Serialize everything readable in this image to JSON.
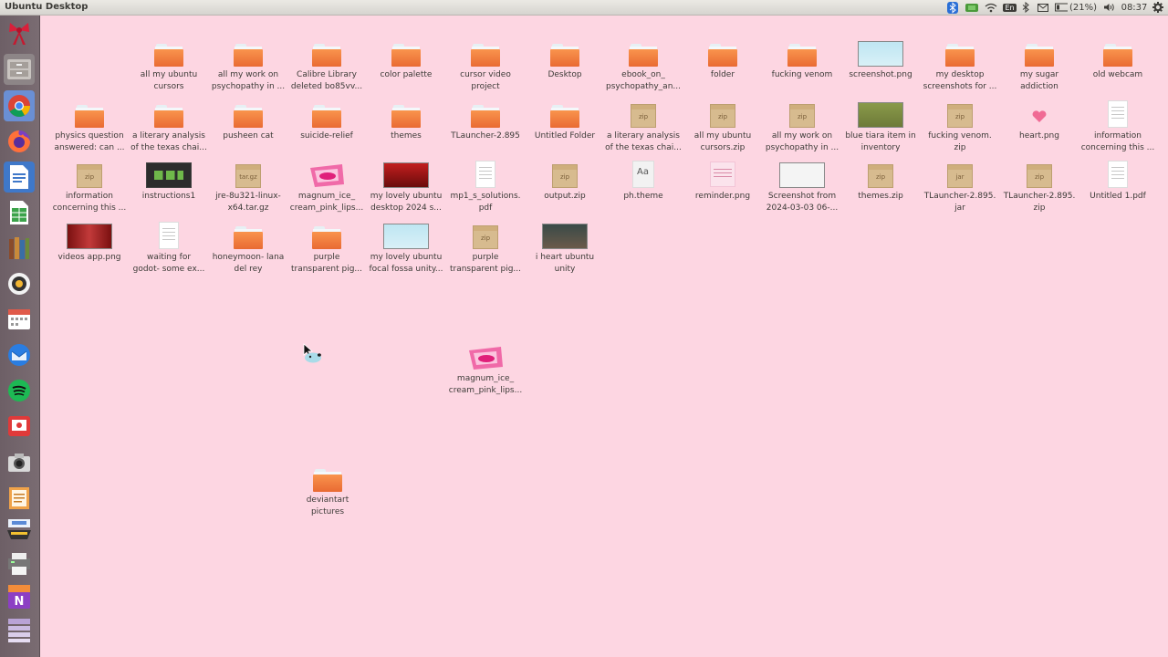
{
  "panel": {
    "title": "Ubuntu Desktop",
    "battery": "(21%)",
    "keyboard": "En",
    "time": "08:37"
  },
  "launcher": {
    "items": [
      "ribbon",
      "files",
      "chrome",
      "firefox",
      "writer",
      "calc",
      "books",
      "rhythmbox",
      "calendar",
      "thunderbird",
      "spotify",
      "screencast",
      "camera",
      "notes",
      "scanner",
      "onenote"
    ]
  },
  "desktop": {
    "icons": [
      {
        "id": "i1",
        "name": "all my ubuntu cursors",
        "l1": "all my ubuntu",
        "l2": "cursors",
        "type": "folder"
      },
      {
        "id": "i2",
        "name": "all my work on psychopathy",
        "l1": "all my work on",
        "l2": "psychopathy in ...",
        "type": "folder"
      },
      {
        "id": "i3",
        "name": "Calibre Library",
        "l1": "Calibre Library",
        "l2": "deleted bo85vv...",
        "type": "folder"
      },
      {
        "id": "i4",
        "name": "color palette",
        "l1": "color palette",
        "l2": "",
        "type": "folder"
      },
      {
        "id": "i5",
        "name": "cursor video project",
        "l1": "cursor video",
        "l2": "project",
        "type": "folder"
      },
      {
        "id": "i6",
        "name": "Desktop",
        "l1": "Desktop",
        "l2": "",
        "type": "folder"
      },
      {
        "id": "i7",
        "name": "ebook on psychopathy",
        "l1": "ebook_on_",
        "l2": "psychopathy_an...",
        "type": "folder"
      },
      {
        "id": "i8",
        "name": "folder",
        "l1": "folder",
        "l2": "",
        "type": "folder"
      },
      {
        "id": "i9",
        "name": "fucking venom",
        "l1": "fucking venom",
        "l2": "",
        "type": "folder"
      },
      {
        "id": "i10",
        "name": "screenshot.png",
        "l1": "screenshot.png",
        "l2": "",
        "type": "screenshot"
      },
      {
        "id": "i11",
        "name": "my desktop screenshots",
        "l1": "my desktop",
        "l2": "screenshots for ...",
        "type": "folder"
      },
      {
        "id": "i12",
        "name": "my sugar addiction",
        "l1": "my sugar",
        "l2": "addiction",
        "type": "folder"
      },
      {
        "id": "i13",
        "name": "old webcam",
        "l1": "old webcam",
        "l2": "",
        "type": "folder"
      },
      {
        "id": "i14",
        "name": "physics question",
        "l1": "physics question",
        "l2": "answered: can ...",
        "type": "folder"
      },
      {
        "id": "i15",
        "name": "a literary analysis",
        "l1": "a literary analysis",
        "l2": "of the texas chai...",
        "type": "folder"
      },
      {
        "id": "i16",
        "name": "pusheen cat",
        "l1": "pusheen cat",
        "l2": "",
        "type": "folder"
      },
      {
        "id": "i17",
        "name": "suicide-relief",
        "l1": "suicide-relief",
        "l2": "",
        "type": "folder"
      },
      {
        "id": "i18",
        "name": "themes",
        "l1": "themes",
        "l2": "",
        "type": "folder"
      },
      {
        "id": "i19",
        "name": "TLauncher-2.895",
        "l1": "TLauncher-2.895",
        "l2": "",
        "type": "folder"
      },
      {
        "id": "i20",
        "name": "Untitled Folder",
        "l1": "Untitled Folder",
        "l2": "",
        "type": "folder"
      },
      {
        "id": "i21",
        "name": "a literary analysis zip",
        "l1": "a literary analysis",
        "l2": "of the texas chai...",
        "type": "zip"
      },
      {
        "id": "i22",
        "name": "all my ubuntu cursors.zip",
        "l1": "all my ubuntu",
        "l2": "cursors.zip",
        "type": "zip"
      },
      {
        "id": "i23",
        "name": "all my work on psychopathy zip",
        "l1": "all my work on",
        "l2": "psychopathy in ...",
        "type": "zip"
      },
      {
        "id": "i24",
        "name": "blue tiara item in inventory",
        "l1": "blue tiara item in",
        "l2": "inventory",
        "type": "game"
      },
      {
        "id": "i25",
        "name": "fucking venom.zip",
        "l1": "fucking venom.",
        "l2": "zip",
        "type": "zip"
      },
      {
        "id": "i26",
        "name": "heart.png",
        "l1": "heart.png",
        "l2": "",
        "type": "heart"
      },
      {
        "id": "i27",
        "name": "information concerning this",
        "l1": "information",
        "l2": "concerning this ...",
        "type": "doc"
      },
      {
        "id": "i28",
        "name": "information concerning this zip",
        "l1": "information",
        "l2": "concerning this ...",
        "type": "zip"
      },
      {
        "id": "i29",
        "name": "instructions1",
        "l1": "instructions1",
        "l2": "",
        "type": "instructions"
      },
      {
        "id": "i30",
        "name": "jre-8u321-linux-x64.tar.gz",
        "l1": "jre-8u321-linux-",
        "l2": "x64.tar.gz",
        "type": "targz"
      },
      {
        "id": "i31",
        "name": "magnum ice cream pink lips",
        "l1": "magnum_ice_",
        "l2": "cream_pink_lips...",
        "type": "pink"
      },
      {
        "id": "i32",
        "name": "my lovely ubuntu desktop 2024",
        "l1": "my lovely ubuntu",
        "l2": "desktop 2024 s...",
        "type": "red"
      },
      {
        "id": "i33",
        "name": "mp1_s_solutions.pdf",
        "l1": "mp1_s_solutions.",
        "l2": "pdf",
        "type": "doc"
      },
      {
        "id": "i34",
        "name": "output.zip",
        "l1": "output.zip",
        "l2": "",
        "type": "zip"
      },
      {
        "id": "i35",
        "name": "ph.theme",
        "l1": "ph.theme",
        "l2": "",
        "type": "theme"
      },
      {
        "id": "i36",
        "name": "reminder.png",
        "l1": "reminder.png",
        "l2": "",
        "type": "reminder"
      },
      {
        "id": "i37",
        "name": "Screenshot from 2024-03-03",
        "l1": "Screenshot from",
        "l2": "2024-03-03 06-...",
        "type": "whiteshot"
      },
      {
        "id": "i38",
        "name": "themes.zip",
        "l1": "themes.zip",
        "l2": "",
        "type": "zip"
      },
      {
        "id": "i39",
        "name": "TLauncher-2.895.jar",
        "l1": "TLauncher-2.895.",
        "l2": "jar",
        "type": "jar"
      },
      {
        "id": "i40",
        "name": "TLauncher-2.895.zip",
        "l1": "TLauncher-2.895.",
        "l2": "zip",
        "type": "zip"
      },
      {
        "id": "i41",
        "name": "Untitled 1.pdf",
        "l1": "Untitled 1.pdf",
        "l2": "",
        "type": "doc"
      },
      {
        "id": "i42",
        "name": "videos app.png",
        "l1": "videos app.png",
        "l2": "",
        "type": "video"
      },
      {
        "id": "i43",
        "name": "waiting for godot",
        "l1": "waiting for",
        "l2": "godot- some ex...",
        "type": "doc"
      },
      {
        "id": "i44",
        "name": "honeymoon- lana del rey",
        "l1": "honeymoon- lana",
        "l2": "del rey",
        "type": "folder"
      },
      {
        "id": "i45",
        "name": "purple transparent pig",
        "l1": "purple",
        "l2": "transparent pig...",
        "type": "folder"
      },
      {
        "id": "i46",
        "name": "my lovely ubuntu focal fossa unity",
        "l1": "my lovely ubuntu",
        "l2": "focal fossa unity...",
        "type": "screenshot"
      },
      {
        "id": "i47",
        "name": "purple transparent pig zip",
        "l1": "purple",
        "l2": "transparent pig...",
        "type": "zip"
      },
      {
        "id": "i48",
        "name": "i heart ubuntu unity",
        "l1": "i heart ubuntu",
        "l2": "unity",
        "type": "dark"
      },
      {
        "id": "i49",
        "name": "magnum ice cream pink lips 2",
        "l1": "magnum_ice_",
        "l2": "cream_pink_lips...",
        "type": "pink"
      },
      {
        "id": "i50",
        "name": "deviantart pictures",
        "l1": "deviantart",
        "l2": "pictures",
        "type": "folder"
      }
    ]
  }
}
